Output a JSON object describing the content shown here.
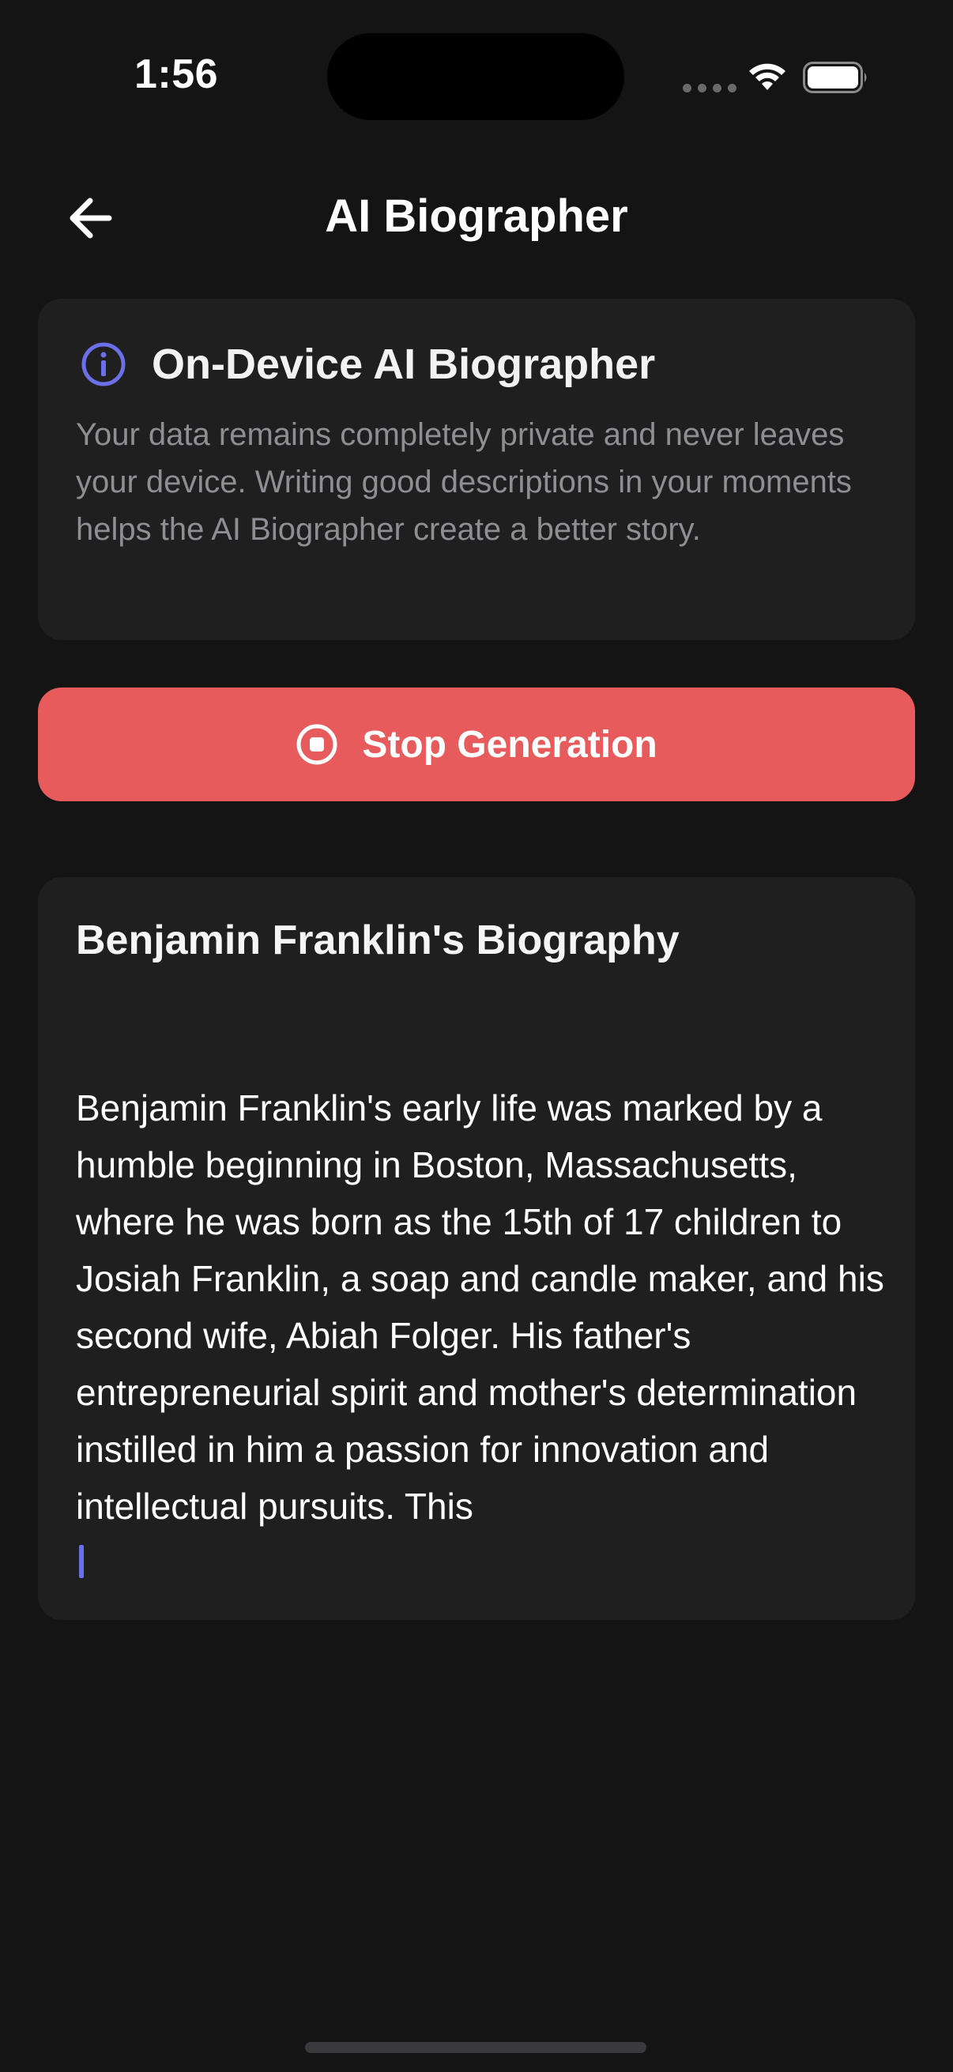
{
  "status_bar": {
    "time": "1:56"
  },
  "header": {
    "title": "AI Biographer",
    "back_icon": "arrow-left-icon"
  },
  "info_card": {
    "icon": "info-icon",
    "title": "On-Device AI Biographer",
    "body": "Your data remains completely private and never leaves your device. Writing good descriptions in your moments helps the AI Biographer create a better story."
  },
  "stop_button": {
    "icon": "stop-circle-icon",
    "label": "Stop Generation"
  },
  "biography": {
    "title": "Benjamin Franklin's Biography",
    "text": "Benjamin Franklin's early life was marked by a humble beginning in Boston, Massachusetts, where he was born as the 15th of 17 children to Josiah Franklin, a soap and candle maker, and his second wife, Abiah Folger. His father's entrepreneurial spirit and mother's determination instilled in him a passion for innovation and intellectual pursuits. This"
  },
  "colors": {
    "background": "#141414",
    "card": "#1f1f20",
    "accent": "#6b6fe8",
    "stop_button": "#e85b5c"
  }
}
